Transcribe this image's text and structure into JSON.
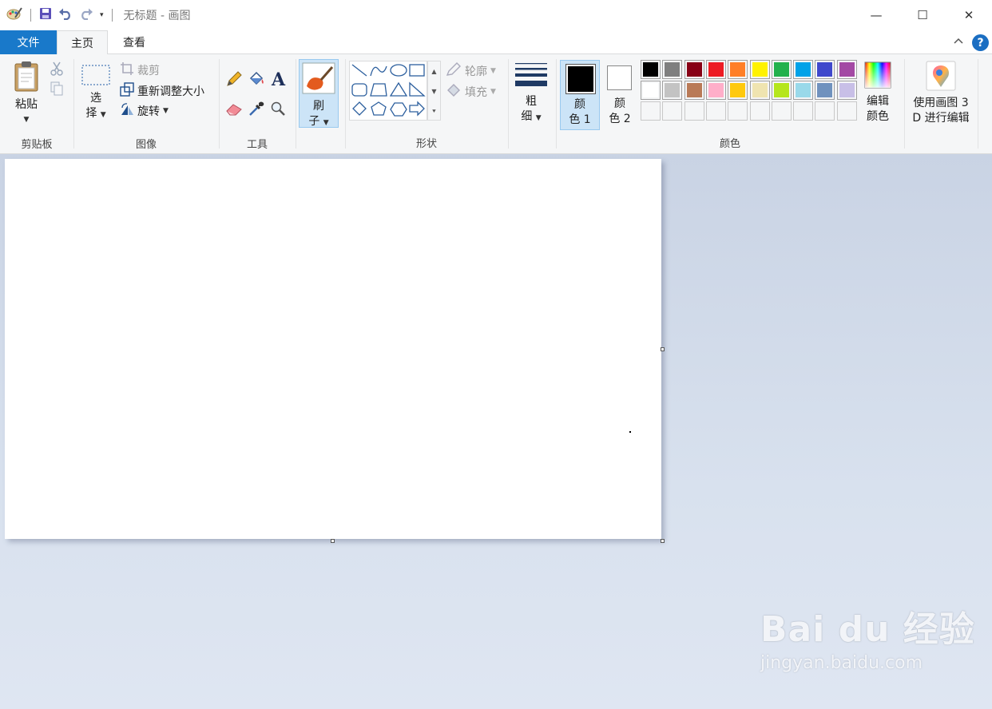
{
  "window": {
    "title": "无标题 - 画图",
    "controls": {
      "minimize": "—",
      "maximize": "☐",
      "close": "✕"
    }
  },
  "qat": {
    "customize_caret": "▾"
  },
  "tabs": [
    {
      "label": "文件"
    },
    {
      "label": "主页"
    },
    {
      "label": "查看"
    }
  ],
  "help": {
    "label": "?"
  },
  "ribbon": {
    "clipboard": {
      "group_label": "剪贴板",
      "paste_label": "粘贴"
    },
    "image": {
      "group_label": "图像",
      "select_line1": "选",
      "select_line2": "择",
      "crop_label": "裁剪",
      "resize_label": "重新调整大小",
      "rotate_label": "旋转"
    },
    "tools": {
      "group_label": "工具"
    },
    "brushes": {
      "line1": "刷",
      "line2": "子"
    },
    "shapes": {
      "group_label": "形状",
      "outline_label": "轮廓",
      "fill_label": "填充"
    },
    "size": {
      "line1": "粗",
      "line2": "细"
    },
    "colors": {
      "group_label": "颜色",
      "color1_line1": "颜",
      "color1_line2": "色 1",
      "color2_line1": "颜",
      "color2_line2": "色 2",
      "color1_value": "#000000",
      "color2_value": "#ffffff",
      "edit_line1": "编辑",
      "edit_line2": "颜色",
      "palette_row1": [
        "#000000",
        "#7f7f7f",
        "#880015",
        "#ed1c24",
        "#ff7f27",
        "#fff200",
        "#22b14c",
        "#00a2e8",
        "#3f48cc",
        "#a349a4"
      ],
      "palette_row2": [
        "#ffffff",
        "#c3c3c3",
        "#b97a57",
        "#ffaec9",
        "#ffc90e",
        "#efe4b0",
        "#b5e61d",
        "#99d9ea",
        "#7092be",
        "#c8bfe7"
      ]
    },
    "paint3d": {
      "line1": "使用画图 3",
      "line2": "D 进行编辑"
    }
  },
  "watermark": {
    "logo": "Bai du 经验",
    "url": "jingyan.baidu.com"
  }
}
